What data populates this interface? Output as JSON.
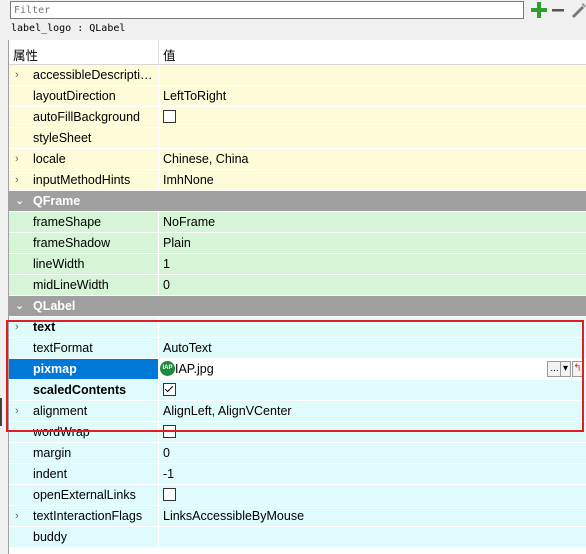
{
  "filter": {
    "placeholder": "Filter"
  },
  "object_label": "label_logo : QLabel",
  "columns": {
    "property": "属性",
    "value": "值"
  },
  "sections": {
    "qframe": "QFrame",
    "qlabel": "QLabel"
  },
  "rows": {
    "accessibleDescription": {
      "name": "accessibleDescripti…",
      "value": ""
    },
    "layoutDirection": {
      "name": "layoutDirection",
      "value": "LeftToRight"
    },
    "autoFillBackground": {
      "name": "autoFillBackground",
      "checked": false
    },
    "styleSheet": {
      "name": "styleSheet",
      "value": ""
    },
    "locale": {
      "name": "locale",
      "value": "Chinese, China"
    },
    "inputMethodHints": {
      "name": "inputMethodHints",
      "value": "ImhNone"
    },
    "frameShape": {
      "name": "frameShape",
      "value": "NoFrame"
    },
    "frameShadow": {
      "name": "frameShadow",
      "value": "Plain"
    },
    "lineWidth": {
      "name": "lineWidth",
      "value": "1"
    },
    "midLineWidth": {
      "name": "midLineWidth",
      "value": "0"
    },
    "text": {
      "name": "text",
      "value": ""
    },
    "textFormat": {
      "name": "textFormat",
      "value": "AutoText"
    },
    "pixmap": {
      "name": "pixmap",
      "value": "IAP.jpg",
      "icon_text": "IAP",
      "browse_label": "..."
    },
    "scaledContents": {
      "name": "scaledContents",
      "checked": true
    },
    "alignment": {
      "name": "alignment",
      "value": "AlignLeft, AlignVCenter"
    },
    "wordWrap": {
      "name": "wordWrap",
      "checked": false
    },
    "margin": {
      "name": "margin",
      "value": "0"
    },
    "indent": {
      "name": "indent",
      "value": "-1"
    },
    "openExternalLinks": {
      "name": "openExternalLinks",
      "checked": false
    },
    "textInteractionFlags": {
      "name": "textInteractionFlags",
      "value": "LinksAccessibleByMouse"
    },
    "buddy": {
      "name": "buddy",
      "value": ""
    }
  },
  "colors": {
    "highlight": "#e02020",
    "selection": "#0078d7",
    "section": "#9f9f9f"
  }
}
